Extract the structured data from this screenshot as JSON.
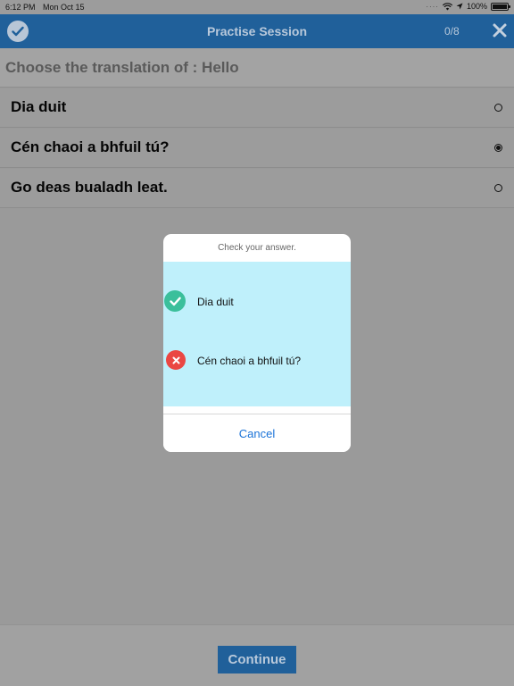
{
  "status_bar": {
    "time": "6:12 PM",
    "date": "Mon Oct 15",
    "battery": "100%"
  },
  "nav": {
    "title": "Practise Session",
    "progress": "0/8"
  },
  "question": "Choose the translation of : Hello",
  "options": [
    {
      "label": "Dia duit",
      "selected": false
    },
    {
      "label": "Cén chaoi a bhfuil tú?",
      "selected": true
    },
    {
      "label": "Go deas bualadh leat.",
      "selected": false
    }
  ],
  "dialog": {
    "title": "Check your answer.",
    "answers": [
      {
        "text": "Dia duit",
        "status": "correct"
      },
      {
        "text": "Cén chaoi a bhfuil tú?",
        "status": "wrong"
      }
    ],
    "cancel_label": "Cancel"
  },
  "continue_label": "Continue",
  "colors": {
    "accent": "#20609a",
    "correct": "#3bbf9b",
    "wrong": "#ea4743",
    "dialog_body": "#bff0fb",
    "link": "#1a73d8"
  },
  "icons": {
    "nav_left": "check-circle-icon",
    "nav_right": "close-icon",
    "correct": "check-icon",
    "wrong": "x-icon"
  }
}
